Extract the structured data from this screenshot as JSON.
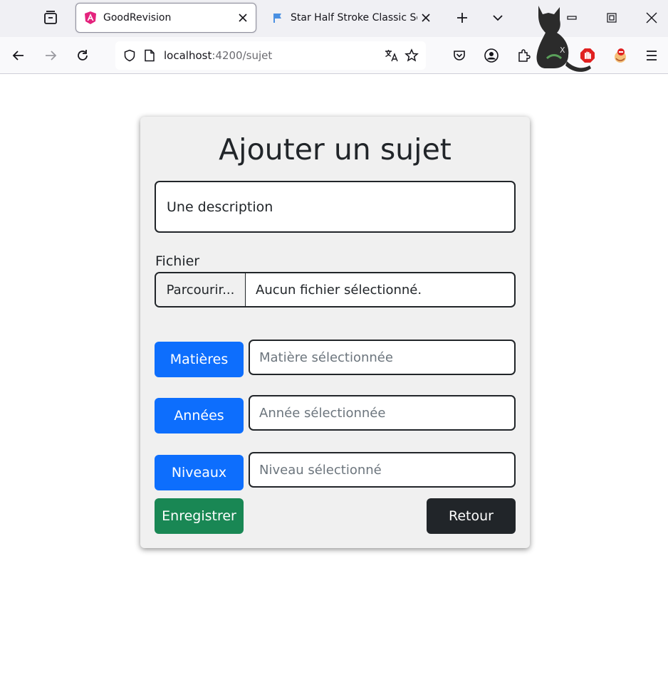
{
  "browser": {
    "tabs": [
      {
        "title": "GoodRevision",
        "active": true
      },
      {
        "title": "Star Half Stroke Classic Solid",
        "active": false
      }
    ],
    "url_host": "localhost",
    "url_path": ":4200/sujet",
    "icons": {
      "tab_list": "tab-list-icon",
      "new_tab": "plus-icon",
      "all_tabs": "chevron-down-icon",
      "back": "arrow-left-icon",
      "forward": "arrow-right-icon",
      "reload": "reload-icon",
      "shield": "shield-icon",
      "page": "page-icon",
      "translate": "translate-icon",
      "bookmark": "star-icon",
      "pocket": "pocket-icon",
      "account": "account-icon",
      "extensions": "puzzle-icon",
      "menu": "hamburger-icon"
    }
  },
  "form": {
    "title": "Ajouter un sujet",
    "description_value": "Une description",
    "file_label": "Fichier",
    "file_button": "Parcourir...",
    "file_status": "Aucun fichier sélectionné.",
    "selectors": [
      {
        "button": "Matières",
        "placeholder": "Matière sélectionnée"
      },
      {
        "button": "Années",
        "placeholder": "Année sélectionnée"
      },
      {
        "button": "Niveaux",
        "placeholder": "Niveau sélectionné"
      }
    ],
    "save_label": "Enregistrer",
    "back_label": "Retour"
  },
  "colors": {
    "primary": "#0d6efd",
    "success": "#198754",
    "dark": "#212529",
    "card_bg": "#f0f0f0"
  }
}
